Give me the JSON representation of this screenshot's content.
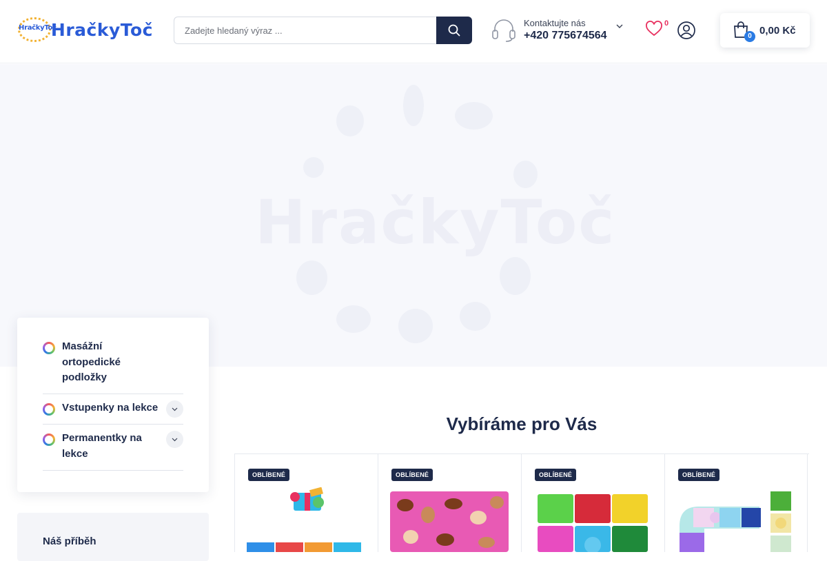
{
  "header": {
    "logo_text": "HračkyToč",
    "logo_badge": "HračkyToč",
    "search": {
      "placeholder": "Zadejte hledaný výraz ...",
      "icon": "search-icon"
    },
    "contact": {
      "label": "Kontaktujte nás",
      "phone": "+420 775674564",
      "icon": "headset-icon"
    },
    "wishlist": {
      "count": "0",
      "icon": "heart-icon"
    },
    "account": {
      "icon": "user-icon"
    },
    "cart": {
      "count": "0",
      "total": "0,00 Kč",
      "icon": "shopping-bag-icon"
    }
  },
  "hero": {
    "watermark": "HračkyToč"
  },
  "sidebar": {
    "categories": [
      {
        "label_lines": [
          "Masážní",
          "ortopedické",
          "podložky"
        ],
        "expandable": false
      },
      {
        "label_lines": [
          "Vstupenky na lekce"
        ],
        "expandable": true
      },
      {
        "label_lines": [
          "Permanentky na",
          "lekce"
        ],
        "expandable": true
      }
    ],
    "story_title": "Náš příběh"
  },
  "main": {
    "section_title": "Vybíráme pro Vás",
    "products": [
      {
        "tag": "OBLÍBENÉ",
        "image": "gift-and-mats-image"
      },
      {
        "tag": "OBLÍBENÉ",
        "image": "mushroom-puzzle-mat-image"
      },
      {
        "tag": "OBLÍBENÉ",
        "image": "colorful-mats-grid-image"
      },
      {
        "tag": "OBLÍBENÉ",
        "image": "mat-path-image"
      }
    ]
  },
  "colors": {
    "primary": "#1e2a4a",
    "accent": "#2a7be4",
    "badge_red": "#e8305f"
  }
}
